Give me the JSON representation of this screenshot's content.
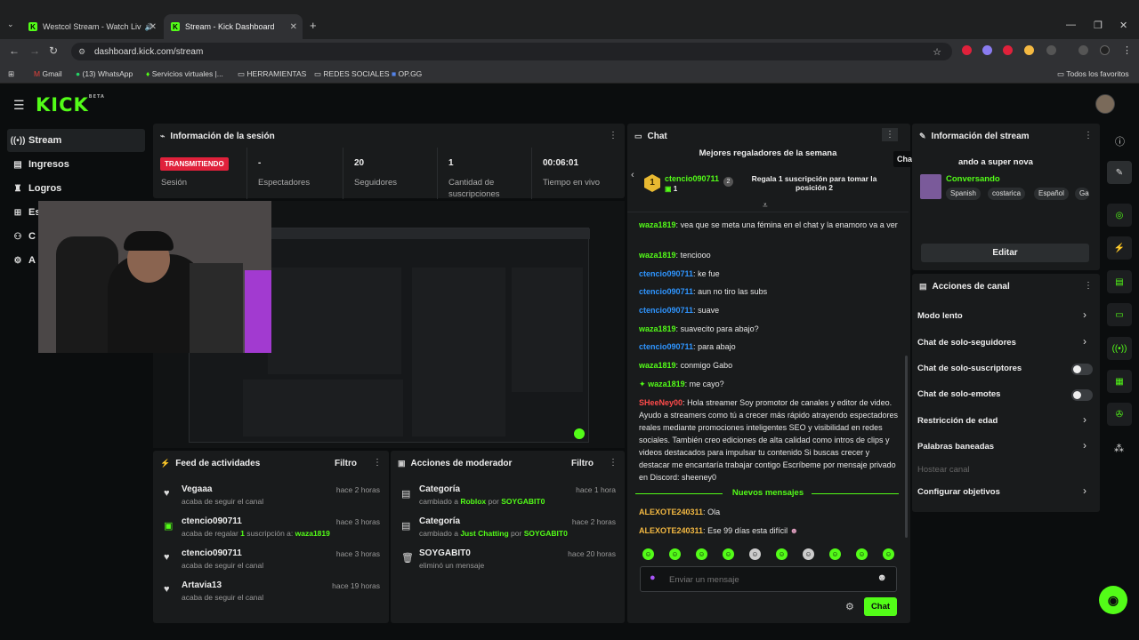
{
  "browser": {
    "tabs": [
      {
        "title": "Westcol Stream - Watch Liv"
      },
      {
        "title": "Stream - Kick Dashboard"
      }
    ],
    "url": "dashboard.kick.com/stream",
    "bookmarks": [
      "Gmail",
      "(13) WhatsApp",
      "Servicios virtuales |...",
      "HERRAMIENTAS",
      "REDES SOCIALES",
      "OP.GG"
    ],
    "all_bookmarks": "Todos los favoritos"
  },
  "app": {
    "logo": "KICK",
    "logo_badge": "BETA"
  },
  "sidebar": {
    "items": [
      {
        "label": "Stream"
      },
      {
        "label": "Ingresos"
      },
      {
        "label": "Logros"
      },
      {
        "label": "Es"
      },
      {
        "label": "C"
      },
      {
        "label": "A"
      }
    ]
  },
  "session": {
    "title": "Información de la sesión",
    "live_badge": "TRANSMITIENDO",
    "live_label": "Sesión",
    "stats": [
      {
        "value": "-",
        "label": "Espectadores"
      },
      {
        "value": "20",
        "label": "Seguidores"
      },
      {
        "value": "1",
        "label": "Cantidad de suscripciones"
      },
      {
        "value": "00:06:01",
        "label": "Tiempo en vivo"
      }
    ]
  },
  "activity": {
    "title": "Feed de actividades",
    "filter": "Filtro",
    "items": [
      {
        "name": "Vegaaa",
        "desc": "acaba de seguir el canal",
        "time": "hace 2 horas"
      },
      {
        "name": "ctencio090711",
        "desc_pre": "acaba de regalar",
        "desc_num": "1",
        "desc_mid": "suscripción a:",
        "desc_user": "waza1819",
        "time": "hace 3 horas"
      },
      {
        "name": "ctencio090711",
        "desc": "acaba de seguir el canal",
        "time": "hace 3 horas"
      },
      {
        "name": "Artavia13",
        "desc": "acaba de seguir el canal",
        "time": "hace 19 horas"
      }
    ]
  },
  "mod": {
    "title": "Acciones de moderador",
    "filter": "Filtro",
    "items": [
      {
        "name": "Categoría",
        "pre": "cambiado a",
        "cat": "Roblox",
        "by": "por",
        "user": "SOYGABIT0",
        "time": "hace 1 hora"
      },
      {
        "name": "Categoría",
        "pre": "cambiado a",
        "cat": "Just Chatting",
        "by": "por",
        "user": "SOYGABIT0",
        "time": "hace 2 horas"
      },
      {
        "name": "SOYGABIT0",
        "desc": "eliminó un mensaje",
        "time": "hace 20 horas"
      }
    ]
  },
  "chat": {
    "title": "Chat",
    "tooltip": "Chat flotante",
    "top_gifters_title": "Mejores regaladores de la semana",
    "gifter_rank": "1",
    "gifter_name": "ctencio090711",
    "gifter_count": "1",
    "gift_prompt": "Regala 1 suscripción para tomar la posición 2",
    "messages": [
      {
        "user": "waza1819",
        "text": "vea que se meta una fémina en el chat y la enamoro va a ver"
      },
      {
        "user": "waza1819",
        "text": "tenciooo"
      },
      {
        "user": "ctencio090711",
        "text": "ke fue"
      },
      {
        "user": "ctencio090711",
        "text": "aun no tiro las subs"
      },
      {
        "user": "ctencio090711",
        "text": "suave"
      },
      {
        "user": "waza1819",
        "text": "suavecito para abajo?"
      },
      {
        "user": "ctencio090711",
        "text": "para abajo"
      },
      {
        "user": "waza1819",
        "text": "conmigo Gabo"
      },
      {
        "user": "waza1819",
        "text": "me cayo?"
      },
      {
        "user": "SHeeNey00",
        "text": "Hola streamer Soy promotor de canales y editor de video. Ayudo a streamers como tú a crecer más rápido atrayendo espectadores reales mediante promociones inteligentes SEO y visibilidad en redes sociales. También creo ediciones de alta calidad como intros de clips y videos destacados para impulsar tu contenido Si buscas crecer y destacar me encantaría trabajar contigo Escríbeme por mensaje privado en Discord: sheeney0"
      },
      {
        "user": "ALEXOTE240311",
        "text": "Ola"
      },
      {
        "user": "ALEXOTE240311",
        "text": "Ese 99 días esta difícil"
      }
    ],
    "new_messages": "Nuevos mensajes",
    "input_placeholder": "Enviar un mensaje",
    "send_label": "Chat"
  },
  "stream_info": {
    "title": "Información del stream",
    "stream_title": "ando a super nova",
    "category": "Conversando",
    "tags": [
      "Spanish",
      "costarica",
      "Español",
      "Ga"
    ],
    "edit_label": "Editar"
  },
  "channel": {
    "title": "Acciones de canal",
    "rows": [
      {
        "label": "Modo lento"
      },
      {
        "label": "Chat de solo-seguidores"
      },
      {
        "label": "Chat de solo-suscriptores"
      },
      {
        "label": "Chat de solo-emotes"
      },
      {
        "label": "Restricción de edad"
      },
      {
        "label": "Palabras baneadas"
      },
      {
        "label": "Hostear canal"
      },
      {
        "label": "Configurar objetivos"
      }
    ]
  },
  "colors": {
    "accent": "#53fc18",
    "live": "#e0213b",
    "panel": "#191b1c"
  }
}
